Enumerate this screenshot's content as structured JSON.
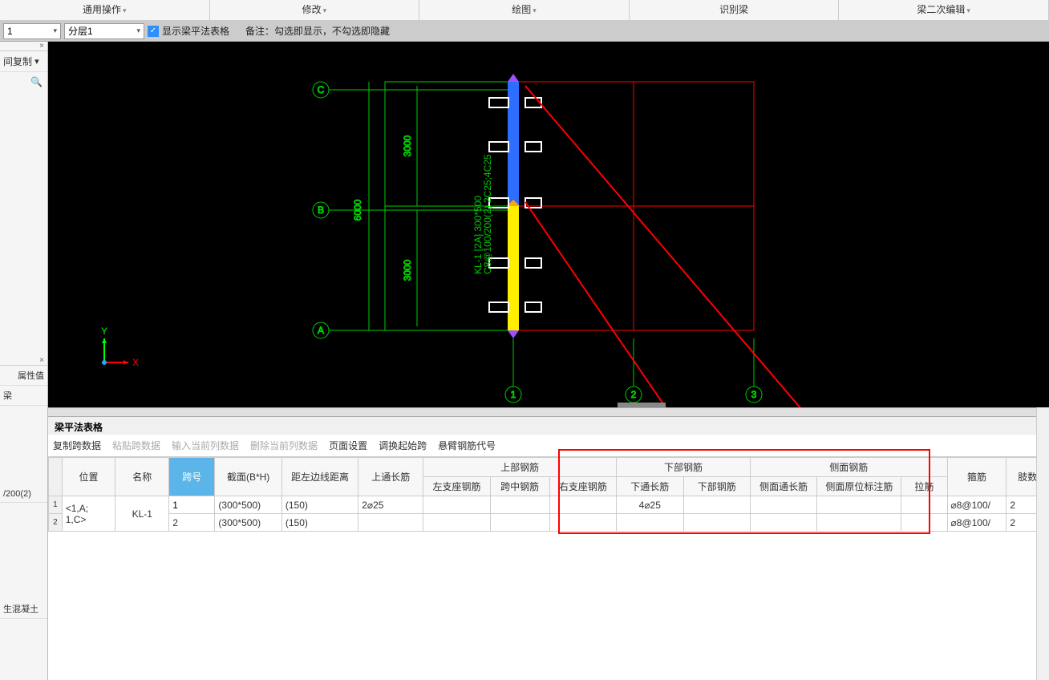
{
  "menu": {
    "items": [
      {
        "label": "通用操作",
        "caret": true
      },
      {
        "label": "修改",
        "caret": true
      },
      {
        "label": "绘图",
        "caret": true
      },
      {
        "label": "识别梁",
        "caret": false
      },
      {
        "label": "梁二次编辑",
        "caret": true
      }
    ]
  },
  "toolbar2": {
    "combo1": "1",
    "combo2": "分层1",
    "checkbox_checked": true,
    "check_label": "显示梁平法表格",
    "note": "备注：勾选即显示，不勾选即隐藏"
  },
  "left": {
    "copy_label": "间复制",
    "search_icon_tip": "search",
    "close_x": "×",
    "prop_header": "属性值",
    "prop_row1": "梁",
    "prop_row2": "/200(2)",
    "prop_row3": "生混凝土",
    "sec_close": "×"
  },
  "canvas": {
    "axisX": "X",
    "axisY": "Y",
    "gridA": "A",
    "gridB": "B",
    "gridC": "C",
    "grid1": "1",
    "grid2": "2",
    "grid3": "3",
    "dimH": "6000",
    "dim3k_top": "3000",
    "dim3k_bot": "3000",
    "beamtag": "KL-1 [2A] 300*500\nC8@100/200(2) 2C25;4C25"
  },
  "pane": {
    "title": "梁平法表格",
    "toolbar": [
      "复制跨数据",
      "粘贴跨数据",
      "输入当前列数据",
      "删除当前列数据",
      "页面设置",
      "调换起始跨",
      "悬臂钢筋代号"
    ],
    "toolbar_disabled": [
      1,
      2,
      3
    ]
  },
  "table": {
    "header_top": {
      "pos": "位置",
      "name": "名称",
      "span": "跨号",
      "section": "截面(B*H)",
      "edge": "距左边线距离",
      "top_full": "上通长筋",
      "upper": "上部钢筋",
      "upper_sub": [
        "左支座钢筋",
        "跨中钢筋",
        "右支座钢筋"
      ],
      "lower": "下部钢筋",
      "lower_sub": [
        "下通长筋",
        "下部钢筋"
      ],
      "side": "侧面钢筋",
      "side_sub": [
        "侧面通长筋",
        "侧面原位标注筋",
        "拉筋"
      ],
      "stirrup": "箍筋",
      "limbs": "肢数"
    },
    "rows": [
      {
        "num": "1",
        "pos": "<1,A;",
        "name": "KL-1",
        "span": "1",
        "section": "(300*500)",
        "edge": "(150)",
        "top_full": "2⌀25",
        "left": "",
        "mid": "",
        "right": "",
        "lower_full": "4⌀25",
        "lower": "",
        "side_full": "",
        "side_pos": "",
        "tie": "",
        "stirrup": "⌀8@100/",
        "limbs": "2"
      },
      {
        "num": "2",
        "pos": "1,C>",
        "name": "",
        "span": "2",
        "section": "(300*500)",
        "edge": "(150)",
        "top_full": "",
        "left": "",
        "mid": "",
        "right": "",
        "lower_full": "",
        "lower": "",
        "side_full": "",
        "side_pos": "",
        "tie": "",
        "stirrup": "⌀8@100/",
        "limbs": "2"
      }
    ]
  }
}
